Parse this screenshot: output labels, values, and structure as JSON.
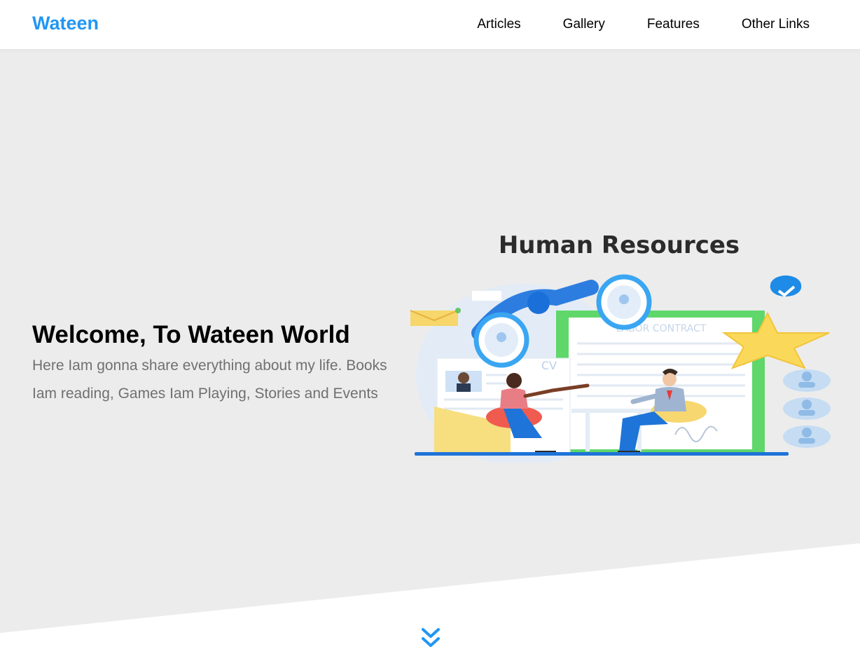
{
  "header": {
    "logo": "Wateen",
    "nav": [
      {
        "label": "Articles"
      },
      {
        "label": "Gallery"
      },
      {
        "label": "Features"
      },
      {
        "label": "Other Links"
      }
    ]
  },
  "hero": {
    "title": "Welcome, To Wateen World",
    "description": "Here Iam gonna share everything about my life. Books Iam reading, Games Iam Playing, Stories and Events",
    "illustration": {
      "heading": "Human Resources",
      "contract_label": "LABOR CONTRACT",
      "cv_label": "CV"
    }
  },
  "colors": {
    "brand": "#2196f3",
    "hero_background": "#ececec"
  },
  "icons": {
    "scroll": "double-chevron-down-icon"
  }
}
